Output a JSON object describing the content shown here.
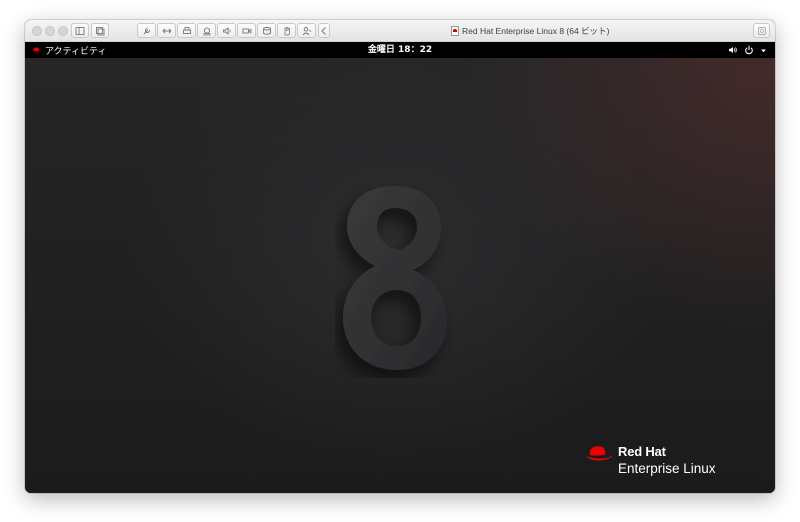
{
  "window": {
    "title": "Red Hat Enterprise Linux 8 (64 ビット)"
  },
  "toolbar": {
    "buttons": [
      "sidebar-icon",
      "snapshot-icon",
      "settings-wrench-icon",
      "resize-arrows-icon",
      "printer-icon",
      "usb-camera-icon",
      "speaker-icon",
      "video-camera-icon",
      "disk-icon",
      "hand-icon",
      "user-icon",
      "back-chevron-icon",
      "fullscreen-icon"
    ]
  },
  "gnome": {
    "activities_label": "アクティビティ",
    "clock": "金曜日 18：22",
    "tray": [
      "volume-icon",
      "power-icon",
      "menu-caret-icon"
    ]
  },
  "desktop": {
    "logo_brand_name": "Red Hat",
    "logo_product_name": "Enterprise Linux",
    "wallpaper_glyph": "8"
  },
  "colors": {
    "redhat_red": "#ee0000",
    "panel_black": "#000000",
    "desktop_dark": "#1e1e1f"
  }
}
